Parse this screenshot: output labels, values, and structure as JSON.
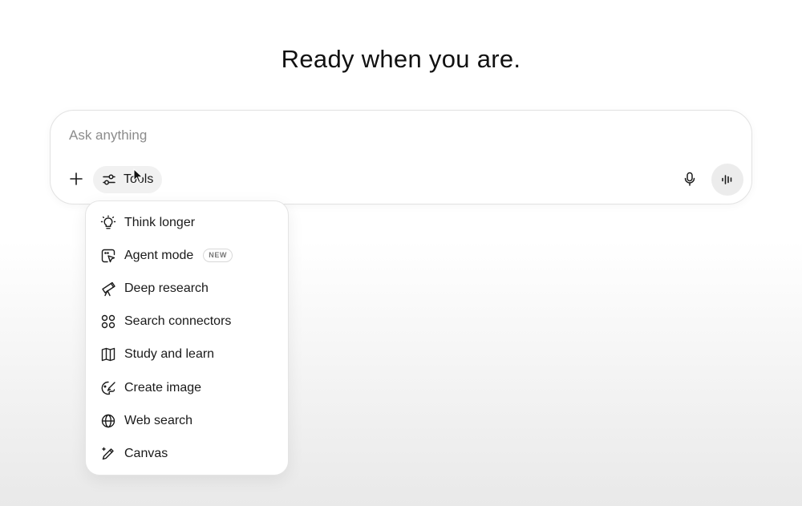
{
  "headline": "Ready when you are.",
  "composer": {
    "placeholder": "Ask anything",
    "value": "",
    "tools_label": "Tools"
  },
  "tools_menu": {
    "items": [
      {
        "label": "Think longer",
        "icon": "lightbulb-icon"
      },
      {
        "label": "Agent mode",
        "icon": "agent-cursor-icon",
        "badge": "NEW"
      },
      {
        "label": "Deep research",
        "icon": "telescope-icon"
      },
      {
        "label": "Search connectors",
        "icon": "connectors-icon"
      },
      {
        "label": "Study and learn",
        "icon": "book-icon"
      },
      {
        "label": "Create image",
        "icon": "palette-icon"
      },
      {
        "label": "Web search",
        "icon": "globe-icon"
      },
      {
        "label": "Canvas",
        "icon": "pencil-sparkle-icon"
      }
    ]
  },
  "colors": {
    "text": "#0d0d0d",
    "placeholder": "#8c8c8c",
    "border": "#e2e2e2",
    "button_bg": "#ececec"
  }
}
